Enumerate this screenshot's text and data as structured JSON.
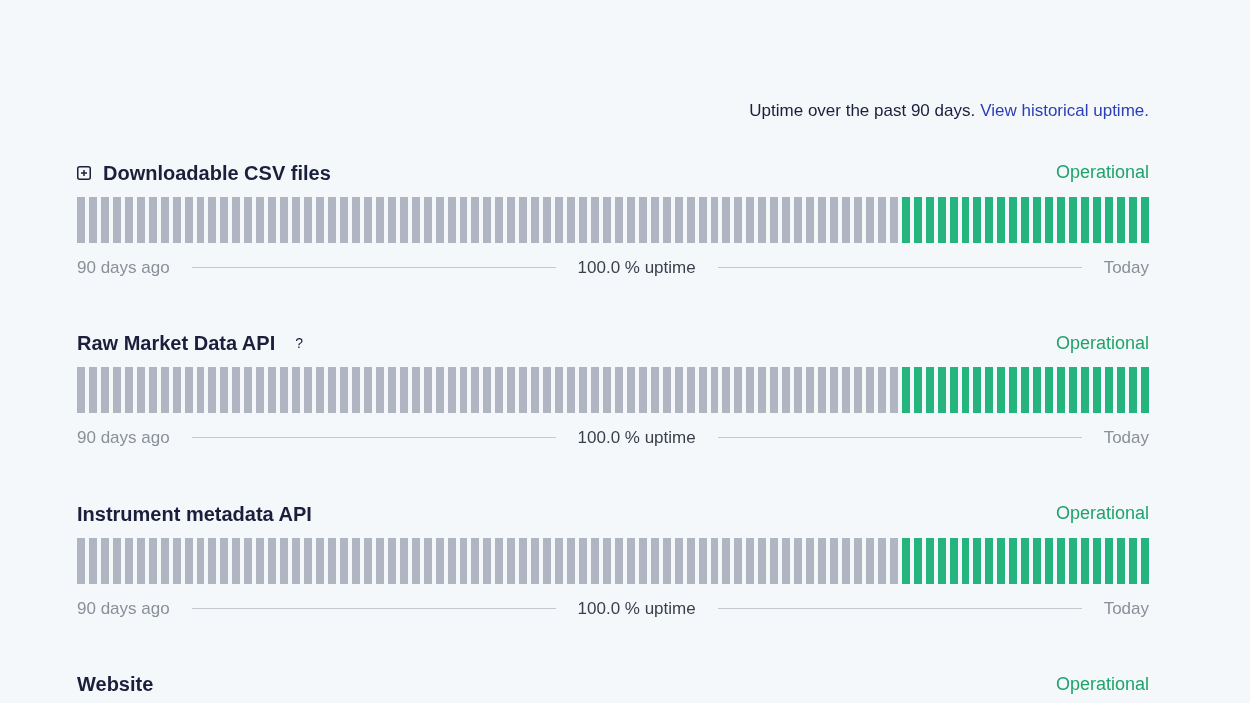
{
  "header": {
    "text": "Uptime over the past 90 days.",
    "link": "View historical uptime."
  },
  "components": [
    {
      "name": "Downloadable CSV files",
      "expanded": false,
      "status": "Operational",
      "days": [
        {
          "color": "#b0b6c1"
        },
        {
          "color": "#b0b6c1"
        },
        {
          "color": "#b0b6c1"
        },
        {
          "color": "#b0b6c1"
        },
        {
          "color": "#b0b6c1"
        },
        {
          "color": "#b0b6c1"
        },
        {
          "color": "#b0b6c1"
        },
        {
          "color": "#b0b6c1"
        },
        {
          "color": "#b0b6c1"
        },
        {
          "color": "#b0b6c1"
        },
        {
          "color": "#b0b6c1"
        },
        {
          "color": "#b0b6c1"
        },
        {
          "color": "#b0b6c1"
        },
        {
          "color": "#b0b6c1"
        },
        {
          "color": "#b0b6c1"
        },
        {
          "color": "#b0b6c1"
        },
        {
          "color": "#b0b6c1"
        },
        {
          "color": "#b0b6c1"
        },
        {
          "color": "#b0b6c1"
        },
        {
          "color": "#b0b6c1"
        },
        {
          "color": "#b0b6c1"
        },
        {
          "color": "#b0b6c1"
        },
        {
          "color": "#b0b6c1"
        },
        {
          "color": "#b0b6c1"
        },
        {
          "color": "#b0b6c1"
        },
        {
          "color": "#b0b6c1"
        },
        {
          "color": "#b0b6c1"
        },
        {
          "color": "#b0b6c1"
        },
        {
          "color": "#b0b6c1"
        },
        {
          "color": "#b0b6c1"
        },
        {
          "color": "#b0b6c1"
        },
        {
          "color": "#b0b6c1"
        },
        {
          "color": "#b0b6c1"
        },
        {
          "color": "#b0b6c1"
        },
        {
          "color": "#b0b6c1"
        },
        {
          "color": "#b0b6c1"
        },
        {
          "color": "#b0b6c1"
        },
        {
          "color": "#b0b6c1"
        },
        {
          "color": "#b0b6c1"
        },
        {
          "color": "#b0b6c1"
        },
        {
          "color": "#b0b6c1"
        },
        {
          "color": "#b0b6c1"
        },
        {
          "color": "#b0b6c1"
        },
        {
          "color": "#b0b6c1"
        },
        {
          "color": "#b0b6c1"
        },
        {
          "color": "#b0b6c1"
        },
        {
          "color": "#b0b6c1"
        },
        {
          "color": "#b0b6c1"
        },
        {
          "color": "#b0b6c1"
        },
        {
          "color": "#b0b6c1"
        },
        {
          "color": "#b0b6c1"
        },
        {
          "color": "#b0b6c1"
        },
        {
          "color": "#b0b6c1"
        },
        {
          "color": "#b0b6c1"
        },
        {
          "color": "#b0b6c1"
        },
        {
          "color": "#b0b6c1"
        },
        {
          "color": "#b0b6c1"
        },
        {
          "color": "#b0b6c1"
        },
        {
          "color": "#b0b6c1"
        },
        {
          "color": "#b0b6c1"
        },
        {
          "color": "#b0b6c1"
        },
        {
          "color": "#b0b6c1"
        },
        {
          "color": "#b0b6c1"
        },
        {
          "color": "#b0b6c1"
        },
        {
          "color": "#b0b6c1"
        },
        {
          "color": "#b0b6c1"
        },
        {
          "color": "#b0b6c1"
        },
        {
          "color": "#b0b6c1"
        },
        {
          "color": "#b0b6c1"
        },
        {
          "color": "#25b47e"
        },
        {
          "color": "#25b47e"
        },
        {
          "color": "#25b47e"
        },
        {
          "color": "#25b47e"
        },
        {
          "color": "#25b47e"
        },
        {
          "color": "#25b47e"
        },
        {
          "color": "#25b47e"
        },
        {
          "color": "#25b47e"
        },
        {
          "color": "#25b47e"
        },
        {
          "color": "#25b47e"
        },
        {
          "color": "#25b47e"
        },
        {
          "color": "#25b47e"
        },
        {
          "color": "#25b47e"
        },
        {
          "color": "#25b47e"
        },
        {
          "color": "#25b47e"
        },
        {
          "color": "#25b47e"
        },
        {
          "color": "#25b47e"
        },
        {
          "color": "#25b47e"
        },
        {
          "color": "#25b47e"
        },
        {
          "color": "#25b47e"
        },
        {
          "color": "#25b47e"
        }
      ],
      "start": "90 days ago",
      "uptime": "100.0 % uptime",
      "end": "Today"
    },
    {
      "name": "Raw Market Data API",
      "help": "?",
      "status": "Operational",
      "days": [
        {
          "color": "#b0b6c1"
        },
        {
          "color": "#b0b6c1"
        },
        {
          "color": "#b0b6c1"
        },
        {
          "color": "#b0b6c1"
        },
        {
          "color": "#b0b6c1"
        },
        {
          "color": "#b0b6c1"
        },
        {
          "color": "#b0b6c1"
        },
        {
          "color": "#b0b6c1"
        },
        {
          "color": "#b0b6c1"
        },
        {
          "color": "#b0b6c1"
        },
        {
          "color": "#b0b6c1"
        },
        {
          "color": "#b0b6c1"
        },
        {
          "color": "#b0b6c1"
        },
        {
          "color": "#b0b6c1"
        },
        {
          "color": "#b0b6c1"
        },
        {
          "color": "#b0b6c1"
        },
        {
          "color": "#b0b6c1"
        },
        {
          "color": "#b0b6c1"
        },
        {
          "color": "#b0b6c1"
        },
        {
          "color": "#b0b6c1"
        },
        {
          "color": "#b0b6c1"
        },
        {
          "color": "#b0b6c1"
        },
        {
          "color": "#b0b6c1"
        },
        {
          "color": "#b0b6c1"
        },
        {
          "color": "#b0b6c1"
        },
        {
          "color": "#b0b6c1"
        },
        {
          "color": "#b0b6c1"
        },
        {
          "color": "#b0b6c1"
        },
        {
          "color": "#b0b6c1"
        },
        {
          "color": "#b0b6c1"
        },
        {
          "color": "#b0b6c1"
        },
        {
          "color": "#b0b6c1"
        },
        {
          "color": "#b0b6c1"
        },
        {
          "color": "#b0b6c1"
        },
        {
          "color": "#b0b6c1"
        },
        {
          "color": "#b0b6c1"
        },
        {
          "color": "#b0b6c1"
        },
        {
          "color": "#b0b6c1"
        },
        {
          "color": "#b0b6c1"
        },
        {
          "color": "#b0b6c1"
        },
        {
          "color": "#b0b6c1"
        },
        {
          "color": "#b0b6c1"
        },
        {
          "color": "#b0b6c1"
        },
        {
          "color": "#b0b6c1"
        },
        {
          "color": "#b0b6c1"
        },
        {
          "color": "#b0b6c1"
        },
        {
          "color": "#b0b6c1"
        },
        {
          "color": "#b0b6c1"
        },
        {
          "color": "#b0b6c1"
        },
        {
          "color": "#b0b6c1"
        },
        {
          "color": "#b0b6c1"
        },
        {
          "color": "#b0b6c1"
        },
        {
          "color": "#b0b6c1"
        },
        {
          "color": "#b0b6c1"
        },
        {
          "color": "#b0b6c1"
        },
        {
          "color": "#b0b6c1"
        },
        {
          "color": "#b0b6c1"
        },
        {
          "color": "#b0b6c1"
        },
        {
          "color": "#b0b6c1"
        },
        {
          "color": "#b0b6c1"
        },
        {
          "color": "#b0b6c1"
        },
        {
          "color": "#b0b6c1"
        },
        {
          "color": "#b0b6c1"
        },
        {
          "color": "#b0b6c1"
        },
        {
          "color": "#b0b6c1"
        },
        {
          "color": "#b0b6c1"
        },
        {
          "color": "#b0b6c1"
        },
        {
          "color": "#b0b6c1"
        },
        {
          "color": "#b0b6c1"
        },
        {
          "color": "#25b47e"
        },
        {
          "color": "#25b47e"
        },
        {
          "color": "#25b47e"
        },
        {
          "color": "#25b47e"
        },
        {
          "color": "#25b47e"
        },
        {
          "color": "#25b47e"
        },
        {
          "color": "#25b47e"
        },
        {
          "color": "#25b47e"
        },
        {
          "color": "#25b47e"
        },
        {
          "color": "#25b47e"
        },
        {
          "color": "#25b47e"
        },
        {
          "color": "#25b47e"
        },
        {
          "color": "#25b47e"
        },
        {
          "color": "#25b47e"
        },
        {
          "color": "#25b47e"
        },
        {
          "color": "#25b47e"
        },
        {
          "color": "#25b47e"
        },
        {
          "color": "#25b47e"
        },
        {
          "color": "#25b47e"
        },
        {
          "color": "#25b47e"
        },
        {
          "color": "#25b47e"
        }
      ],
      "start": "90 days ago",
      "uptime": "100.0 % uptime",
      "end": "Today"
    },
    {
      "name": "Instrument metadata API",
      "status": "Operational",
      "days": [
        {
          "color": "#b0b6c1"
        },
        {
          "color": "#b0b6c1"
        },
        {
          "color": "#b0b6c1"
        },
        {
          "color": "#b0b6c1"
        },
        {
          "color": "#b0b6c1"
        },
        {
          "color": "#b0b6c1"
        },
        {
          "color": "#b0b6c1"
        },
        {
          "color": "#b0b6c1"
        },
        {
          "color": "#b0b6c1"
        },
        {
          "color": "#b0b6c1"
        },
        {
          "color": "#b0b6c1"
        },
        {
          "color": "#b0b6c1"
        },
        {
          "color": "#b0b6c1"
        },
        {
          "color": "#b0b6c1"
        },
        {
          "color": "#b0b6c1"
        },
        {
          "color": "#b0b6c1"
        },
        {
          "color": "#b0b6c1"
        },
        {
          "color": "#b0b6c1"
        },
        {
          "color": "#b0b6c1"
        },
        {
          "color": "#b0b6c1"
        },
        {
          "color": "#b0b6c1"
        },
        {
          "color": "#b0b6c1"
        },
        {
          "color": "#b0b6c1"
        },
        {
          "color": "#b0b6c1"
        },
        {
          "color": "#b0b6c1"
        },
        {
          "color": "#b0b6c1"
        },
        {
          "color": "#b0b6c1"
        },
        {
          "color": "#b0b6c1"
        },
        {
          "color": "#b0b6c1"
        },
        {
          "color": "#b0b6c1"
        },
        {
          "color": "#b0b6c1"
        },
        {
          "color": "#b0b6c1"
        },
        {
          "color": "#b0b6c1"
        },
        {
          "color": "#b0b6c1"
        },
        {
          "color": "#b0b6c1"
        },
        {
          "color": "#b0b6c1"
        },
        {
          "color": "#b0b6c1"
        },
        {
          "color": "#b0b6c1"
        },
        {
          "color": "#b0b6c1"
        },
        {
          "color": "#b0b6c1"
        },
        {
          "color": "#b0b6c1"
        },
        {
          "color": "#b0b6c1"
        },
        {
          "color": "#b0b6c1"
        },
        {
          "color": "#b0b6c1"
        },
        {
          "color": "#b0b6c1"
        },
        {
          "color": "#b0b6c1"
        },
        {
          "color": "#b0b6c1"
        },
        {
          "color": "#b0b6c1"
        },
        {
          "color": "#b0b6c1"
        },
        {
          "color": "#b0b6c1"
        },
        {
          "color": "#b0b6c1"
        },
        {
          "color": "#b0b6c1"
        },
        {
          "color": "#b0b6c1"
        },
        {
          "color": "#b0b6c1"
        },
        {
          "color": "#b0b6c1"
        },
        {
          "color": "#b0b6c1"
        },
        {
          "color": "#b0b6c1"
        },
        {
          "color": "#b0b6c1"
        },
        {
          "color": "#b0b6c1"
        },
        {
          "color": "#b0b6c1"
        },
        {
          "color": "#b0b6c1"
        },
        {
          "color": "#b0b6c1"
        },
        {
          "color": "#b0b6c1"
        },
        {
          "color": "#b0b6c1"
        },
        {
          "color": "#b0b6c1"
        },
        {
          "color": "#b0b6c1"
        },
        {
          "color": "#b0b6c1"
        },
        {
          "color": "#b0b6c1"
        },
        {
          "color": "#b0b6c1"
        },
        {
          "color": "#25b47e"
        },
        {
          "color": "#25b47e"
        },
        {
          "color": "#25b47e"
        },
        {
          "color": "#25b47e"
        },
        {
          "color": "#25b47e"
        },
        {
          "color": "#25b47e"
        },
        {
          "color": "#25b47e"
        },
        {
          "color": "#25b47e"
        },
        {
          "color": "#25b47e"
        },
        {
          "color": "#25b47e"
        },
        {
          "color": "#25b47e"
        },
        {
          "color": "#25b47e"
        },
        {
          "color": "#25b47e"
        },
        {
          "color": "#25b47e"
        },
        {
          "color": "#25b47e"
        },
        {
          "color": "#25b47e"
        },
        {
          "color": "#25b47e"
        },
        {
          "color": "#25b47e"
        },
        {
          "color": "#25b47e"
        },
        {
          "color": "#25b47e"
        },
        {
          "color": "#25b47e"
        }
      ],
      "start": "90 days ago",
      "uptime": "100.0 % uptime",
      "end": "Today"
    },
    {
      "name": "Website",
      "status": "Operational"
    }
  ]
}
